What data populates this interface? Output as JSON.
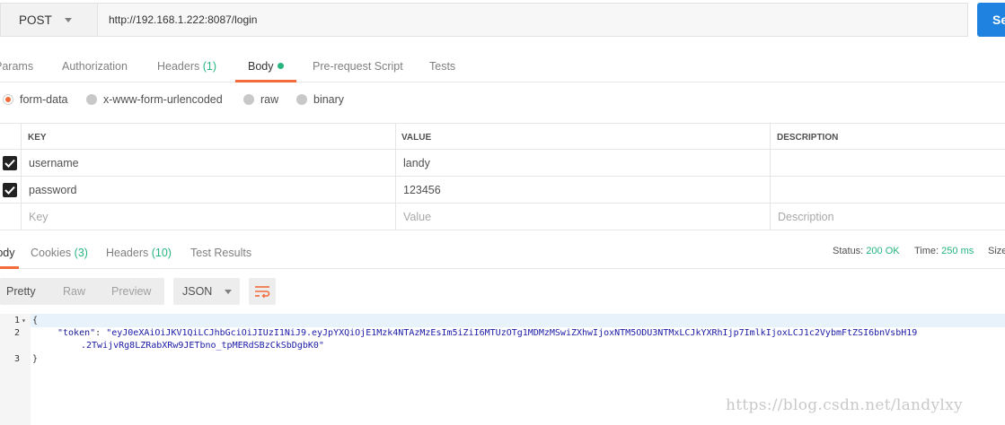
{
  "request": {
    "method": "POST",
    "url": "http://192.168.1.222:8087/login",
    "send_label": "Se"
  },
  "request_tabs": [
    {
      "label": "Params"
    },
    {
      "label": "Authorization"
    },
    {
      "label": "Headers",
      "count": "(1)"
    },
    {
      "label": "Body"
    },
    {
      "label": "Pre-request Script"
    },
    {
      "label": "Tests"
    }
  ],
  "body_types": [
    {
      "label": "form-data",
      "selected": true
    },
    {
      "label": "x-www-form-urlencoded",
      "selected": false
    },
    {
      "label": "raw",
      "selected": false
    },
    {
      "label": "binary",
      "selected": false
    }
  ],
  "kv_table": {
    "headers": [
      "KEY",
      "VALUE",
      "DESCRIPTION"
    ],
    "rows": [
      {
        "checked": true,
        "key": "username",
        "value": "landy",
        "description": ""
      },
      {
        "checked": true,
        "key": "password",
        "value": "123456",
        "description": ""
      }
    ],
    "placeholder": {
      "key": "Key",
      "value": "Value",
      "description": "Description"
    }
  },
  "response_tabs": [
    {
      "label": "Body"
    },
    {
      "label": "Cookies",
      "count": "(3)"
    },
    {
      "label": "Headers",
      "count": "(10)"
    },
    {
      "label": "Test Results"
    }
  ],
  "response_status": {
    "status_label": "Status:",
    "status_value": "200 OK",
    "time_label": "Time:",
    "time_value": "250 ms",
    "size_label": "Size"
  },
  "view_modes": [
    "Pretty",
    "Raw",
    "Preview"
  ],
  "format": "JSON",
  "code": {
    "line_numbers": [
      "1",
      "2",
      "3"
    ],
    "open_brace": "{",
    "close_brace": "}",
    "token_key": "\"token\"",
    "colon": ": ",
    "token_value_1": "\"eyJ0eXAiOiJKV1QiLCJhbGciOiJIUzI1NiJ9.eyJpYXQiOjE1Mzk4NTAzMzEsIm5iZiI6MTUzOTg1MDMzMSwiZXhwIjoxNTM5ODU3NTMxLCJkYXRhIjp7ImlkIjoxLCJ1c2VybmFtZSI6bnVsbH19",
    "token_value_2": ".2TwijvRg8LZRabXRw9JETbno_tpMERdSBzCkSbDgbK0\""
  },
  "watermark": "https://blog.csdn.net/landylxy",
  "colors": {
    "accent": "#f26b3a",
    "green": "#26b47f",
    "send_blue": "#1f82e0"
  }
}
